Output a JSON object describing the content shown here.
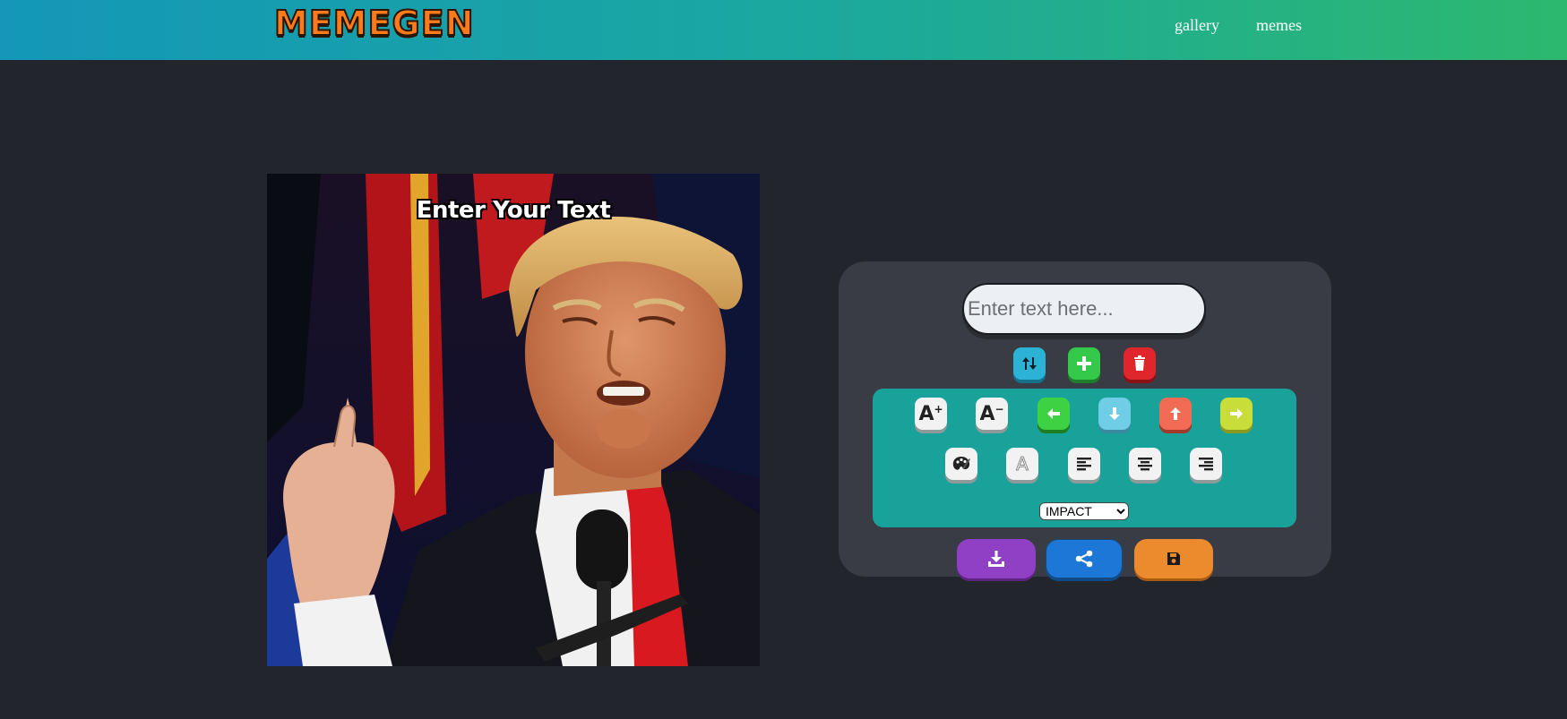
{
  "header": {
    "logo_text": "MEMEGEN",
    "nav": [
      {
        "label": "gallery"
      },
      {
        "label": "memes"
      }
    ]
  },
  "meme": {
    "text": "Enter Your Text"
  },
  "editor": {
    "text_input": {
      "value": "",
      "placeholder": "Enter text here..."
    },
    "row_buttons": [
      "switch-lines-icon",
      "add-line-icon",
      "delete-line-icon"
    ],
    "font_select": {
      "selected": "IMPACT",
      "options": [
        "IMPACT"
      ]
    },
    "font_size_up_label": "A",
    "font_size_down_label": "A",
    "stroke_label": "A",
    "colors": {
      "header_start": "#1497b8",
      "header_end": "#2db86f",
      "tools_bg": "#18a29a",
      "download": "#9040c4",
      "share": "#1d77d6",
      "save": "#ec8b2d"
    }
  }
}
